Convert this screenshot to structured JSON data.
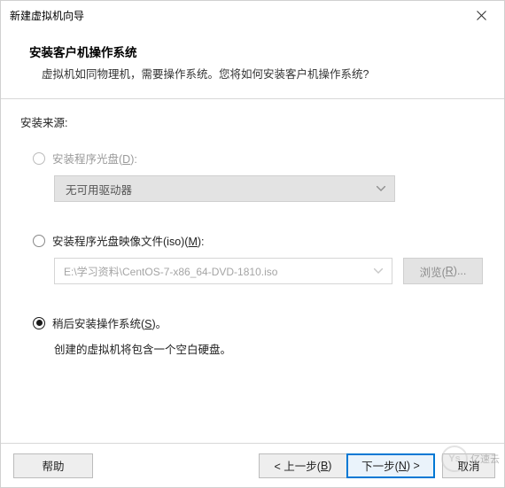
{
  "titlebar": {
    "title": "新建虚拟机向导"
  },
  "header": {
    "title": "安装客户机操作系统",
    "desc": "虚拟机如同物理机，需要操作系统。您将如何安装客户机操作系统?"
  },
  "source_label": "安装来源:",
  "opt_disc": {
    "label_pre": "安装程序光盘(",
    "hotkey": "D",
    "label_post": "):",
    "dropdown_text": "无可用驱动器"
  },
  "opt_iso": {
    "label_pre": "安装程序光盘映像文件(iso)(",
    "hotkey": "M",
    "label_post": "):",
    "path": "E:\\学习资料\\CentOS-7-x86_64-DVD-1810.iso",
    "browse_pre": "浏览(",
    "browse_hot": "R",
    "browse_post": ")..."
  },
  "opt_later": {
    "label_pre": "稍后安装操作系统(",
    "hotkey": "S",
    "label_post": ")。",
    "desc": "创建的虚拟机将包含一个空白硬盘。"
  },
  "footer": {
    "help": "帮助",
    "back_pre": "< 上一步(",
    "back_hot": "B",
    "back_post": ")",
    "next_pre": "下一步(",
    "next_hot": "N",
    "next_post": ") >",
    "cancel": "取消"
  },
  "watermark": {
    "logo": "Ys",
    "text": "亿速云"
  }
}
